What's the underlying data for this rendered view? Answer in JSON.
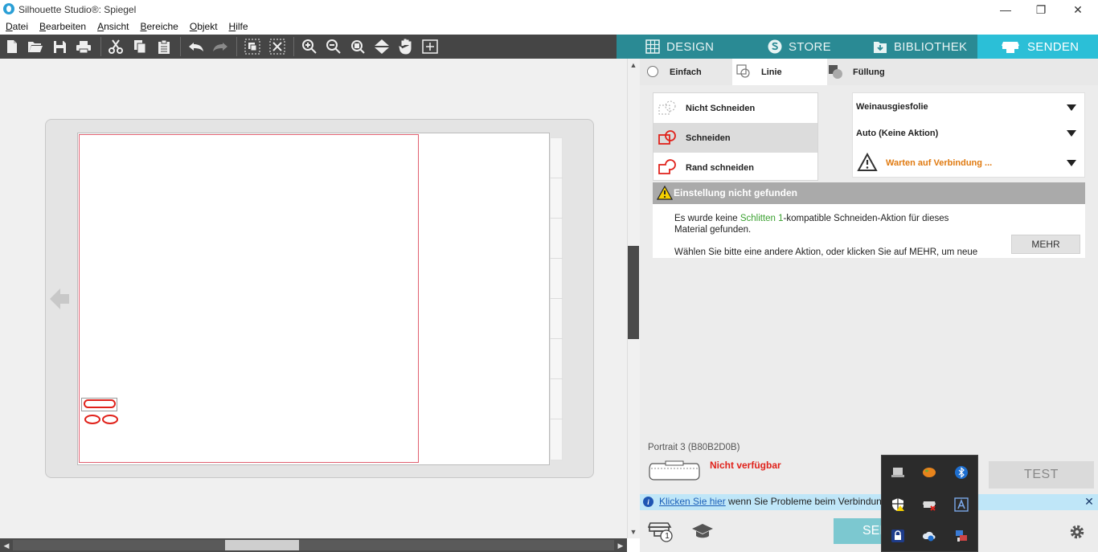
{
  "window": {
    "title": "Silhouette Studio®: Spiegel",
    "controls": {
      "minimize": "—",
      "restore": "❐",
      "close": "✕"
    }
  },
  "menubar": {
    "items": [
      "Datei",
      "Bearbeiten",
      "Ansicht",
      "Bereiche",
      "Objekt",
      "Hilfe"
    ]
  },
  "toolbar": {
    "icons": [
      "new-file-icon",
      "open-folder-icon",
      "save-icon",
      "print-icon",
      "cut-icon",
      "copy-icon",
      "paste-icon",
      "undo-icon",
      "redo-icon",
      "group-icon",
      "ungroup-icon",
      "zoom-in-icon",
      "zoom-out-icon",
      "zoom-fit-icon",
      "move-down-icon",
      "pan-hand-icon",
      "zoom-box-icon"
    ]
  },
  "tabs": [
    {
      "label": "DESIGN",
      "icon": "design-grid-icon",
      "active": false
    },
    {
      "label": "STORE",
      "icon": "store-s-icon",
      "active": false
    },
    {
      "label": "BIBLIOTHEK",
      "icon": "library-download-icon",
      "active": false
    },
    {
      "label": "SENDEN",
      "icon": "send-cutter-icon",
      "active": true
    }
  ],
  "mode": {
    "einfach": "Einfach",
    "linie": "Linie",
    "fuellung": "Füllung",
    "selected": "Linie"
  },
  "actions": [
    {
      "label": "Nicht Schneiden",
      "icon": "no-cut-icon",
      "selected": false
    },
    {
      "label": "Schneiden",
      "icon": "cut-shape-icon",
      "selected": true
    },
    {
      "label": "Rand schneiden",
      "icon": "edge-cut-icon",
      "selected": false
    }
  ],
  "settings": {
    "material": "Weinausgiesfolie",
    "action": "Auto (Keine Aktion)",
    "tool": "Warten auf Verbindung ..."
  },
  "warning": {
    "title": "Einstellung nicht gefunden",
    "line1_pre": "Es wurde keine ",
    "line1_link": "Schlitten 1",
    "line1_post": "-kompatible Schneiden-Aktion für dieses",
    "line2": "Material gefunden.",
    "line3": "Wählen Sie bitte eine andere Aktion, oder klicken Sie auf MEHR, um neue",
    "more_button": "MEHR"
  },
  "device": {
    "name": "Portrait 3 (B80B2D0B)",
    "status": "Nicht verfügbar",
    "test_button": "TEST"
  },
  "infobar": {
    "link": "Klicken Sie hier",
    "text": " wenn Sie Probleme beim Verbindung"
  },
  "bottom": {
    "send_button": "SEN",
    "send_badge": "1"
  },
  "tray": {
    "icons": [
      "laptop-icon",
      "palette-icon",
      "bluetooth-icon",
      "defender-shield-icon",
      "printer-error-icon",
      "text-a-icon",
      "lock-icon",
      "cloud-sync-icon",
      "network-icon"
    ]
  },
  "colors": {
    "accent": "#2bbfd7",
    "tab_bar": "#2a8a94",
    "toolbar": "#454545",
    "cut_line": "#e0221b",
    "warning_text": "#e07a10",
    "error": "#e0221b"
  }
}
